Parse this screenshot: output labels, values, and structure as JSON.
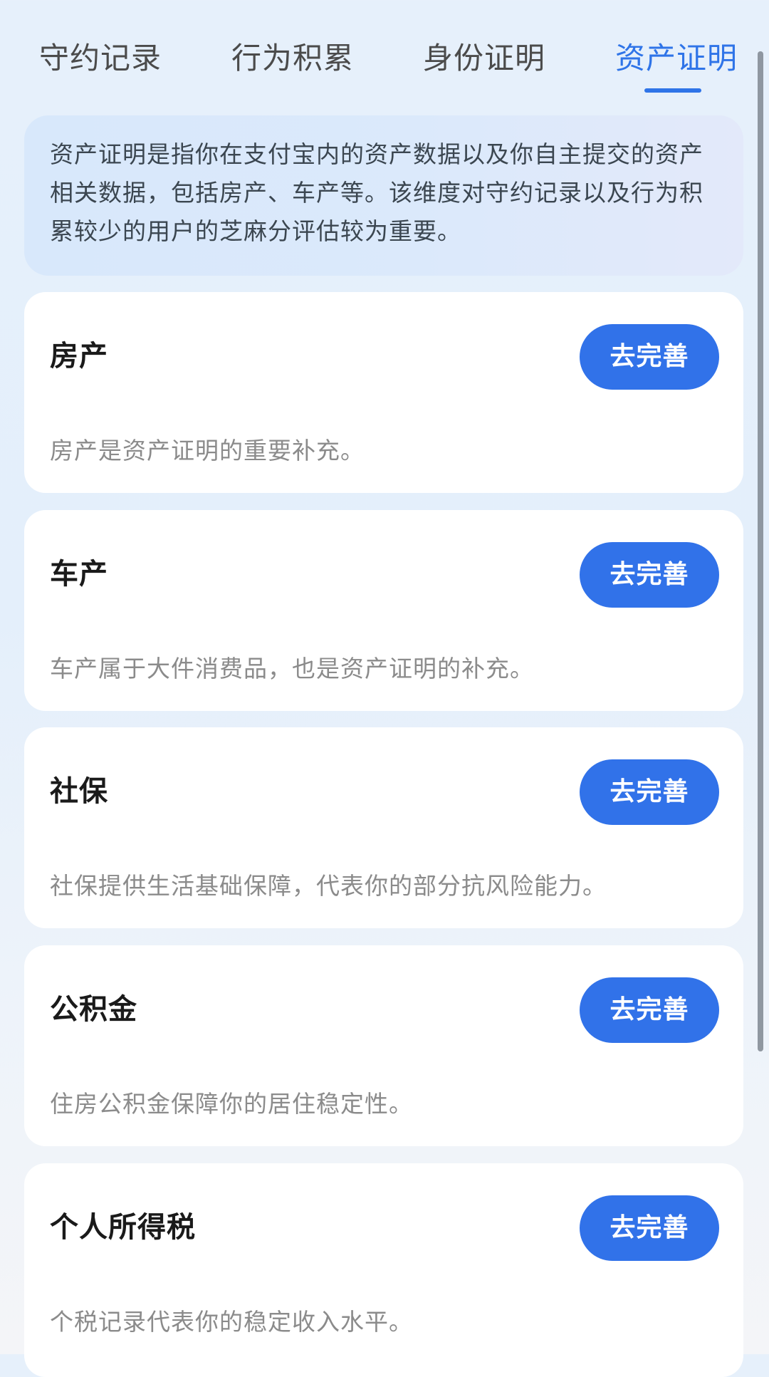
{
  "tabs": [
    {
      "label": "守约记录",
      "active": false
    },
    {
      "label": "行为积累",
      "active": false
    },
    {
      "label": "身份证明",
      "active": false
    },
    {
      "label": "资产证明",
      "active": true
    }
  ],
  "info": {
    "lines": [
      "资产证明是指你在支付宝内的资产数据以及你自主提交的资产",
      "相关数据，包括房产、车产等。该维度对守约记录以及行为积",
      "累较少的用户的芝麻分评估较为重要。"
    ]
  },
  "cards": [
    {
      "title": "房产",
      "button": "去完善",
      "desc": "房产是资产证明的重要补充。"
    },
    {
      "title": "车产",
      "button": "去完善",
      "desc": "车产属于大件消费品，也是资产证明的补充。"
    },
    {
      "title": "社保",
      "button": "去完善",
      "desc": "社保提供生活基础保障，代表你的部分抗风险能力。"
    },
    {
      "title": "公积金",
      "button": "去完善",
      "desc": "住房公积金保障你的居住稳定性。"
    },
    {
      "title": "个人所得税",
      "button": "去完善",
      "desc": "个税记录代表你的稳定收入水平。"
    }
  ],
  "colors": {
    "accent": "#2f74e8",
    "button": "#3172e9",
    "tab_inactive": "#4b4b4b",
    "desc_text": "#8b8b8b"
  }
}
